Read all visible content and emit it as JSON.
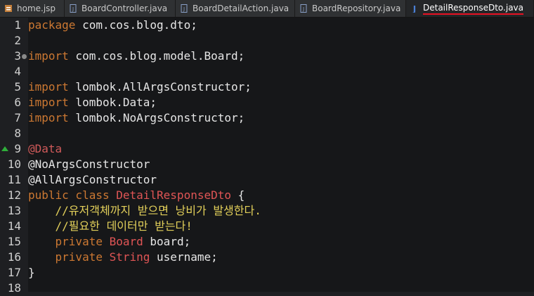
{
  "tabs": [
    {
      "label": "home.jsp",
      "icon": "jsp-file-icon",
      "active": false
    },
    {
      "label": "BoardController.java",
      "icon": "java-file-icon",
      "active": false
    },
    {
      "label": "BoardDetailAction.java",
      "icon": "java-file-icon",
      "active": false
    },
    {
      "label": "BoardRepository.java",
      "icon": "java-file-icon",
      "active": false
    },
    {
      "label": "DetailResponseDto.java",
      "icon": "java-class-icon",
      "active": true
    }
  ],
  "colors": {
    "accent": "#e81123",
    "marker": "#2fae3a",
    "annotation": "#d05a5a",
    "comment": "#e3d05a"
  },
  "lines": [
    {
      "n": "1",
      "parts": [
        {
          "t": "package",
          "c": "kw"
        },
        {
          "t": " com.cos.blog.dto;",
          "c": "pl"
        }
      ]
    },
    {
      "n": "2",
      "parts": []
    },
    {
      "n": "3",
      "parts": [
        {
          "t": "import",
          "c": "kw"
        },
        {
          "t": " com.cos.blog.model.Board;",
          "c": "pl"
        }
      ]
    },
    {
      "n": "4",
      "parts": []
    },
    {
      "n": "5",
      "parts": [
        {
          "t": "import",
          "c": "kw"
        },
        {
          "t": " lombok.AllArgsConstructor;",
          "c": "pl"
        }
      ]
    },
    {
      "n": "6",
      "parts": [
        {
          "t": "import",
          "c": "kw"
        },
        {
          "t": " lombok.Data;",
          "c": "pl"
        }
      ]
    },
    {
      "n": "7",
      "parts": [
        {
          "t": "import",
          "c": "kw"
        },
        {
          "t": " lombok.NoArgsConstructor;",
          "c": "pl"
        }
      ]
    },
    {
      "n": "8",
      "parts": []
    },
    {
      "n": "9",
      "parts": [
        {
          "t": "@Data",
          "c": "ann"
        }
      ]
    },
    {
      "n": "10",
      "parts": [
        {
          "t": "@NoArgsConstructor",
          "c": "pl"
        }
      ]
    },
    {
      "n": "11",
      "parts": [
        {
          "t": "@AllArgsConstructor",
          "c": "pl"
        }
      ]
    },
    {
      "n": "12",
      "parts": [
        {
          "t": "public class",
          "c": "kw"
        },
        {
          "t": " ",
          "c": "pl"
        },
        {
          "t": "DetailResponseDto",
          "c": "typ"
        },
        {
          "t": " {",
          "c": "pl"
        }
      ]
    },
    {
      "n": "13",
      "parts": [
        {
          "t": "    //유저객체까지 받으면 낭비가 발생한다.",
          "c": "cm"
        }
      ]
    },
    {
      "n": "14",
      "parts": [
        {
          "t": "    //필요한 데이터만 받는다!",
          "c": "cm"
        }
      ]
    },
    {
      "n": "15",
      "parts": [
        {
          "t": "    ",
          "c": "pl"
        },
        {
          "t": "private",
          "c": "kw"
        },
        {
          "t": " ",
          "c": "pl"
        },
        {
          "t": "Board",
          "c": "typ"
        },
        {
          "t": " board;",
          "c": "pl"
        }
      ]
    },
    {
      "n": "16",
      "parts": [
        {
          "t": "    ",
          "c": "pl"
        },
        {
          "t": "private",
          "c": "kw"
        },
        {
          "t": " ",
          "c": "pl"
        },
        {
          "t": "String",
          "c": "typ"
        },
        {
          "t": " username;",
          "c": "pl"
        }
      ]
    },
    {
      "n": "17",
      "parts": [
        {
          "t": "}",
          "c": "pl"
        }
      ]
    },
    {
      "n": "18",
      "parts": []
    }
  ]
}
